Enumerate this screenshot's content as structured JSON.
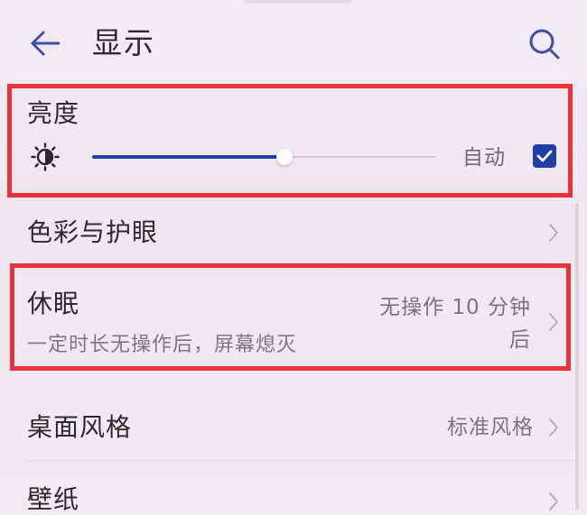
{
  "header": {
    "title": "显示",
    "back_icon": "back-arrow-icon",
    "search_icon": "search-icon"
  },
  "brightness": {
    "title": "亮度",
    "icon": "brightness-icon",
    "level": 0.56,
    "auto_label": "自动",
    "auto_checked": true
  },
  "rows": {
    "color": {
      "title": "色彩与护眼"
    },
    "sleep": {
      "title": "休眠",
      "subtitle": "一定时长无操作后，屏幕熄灭",
      "value_line1": "无操作 10 分钟",
      "value_line2": "后"
    },
    "desktop_style": {
      "title": "桌面风格",
      "value": "标准风格"
    },
    "wallpaper": {
      "title": "壁纸"
    }
  },
  "colors": {
    "accent": "#1f3fa6",
    "highlight": "#e8323c",
    "background": "#f1e8f1"
  }
}
